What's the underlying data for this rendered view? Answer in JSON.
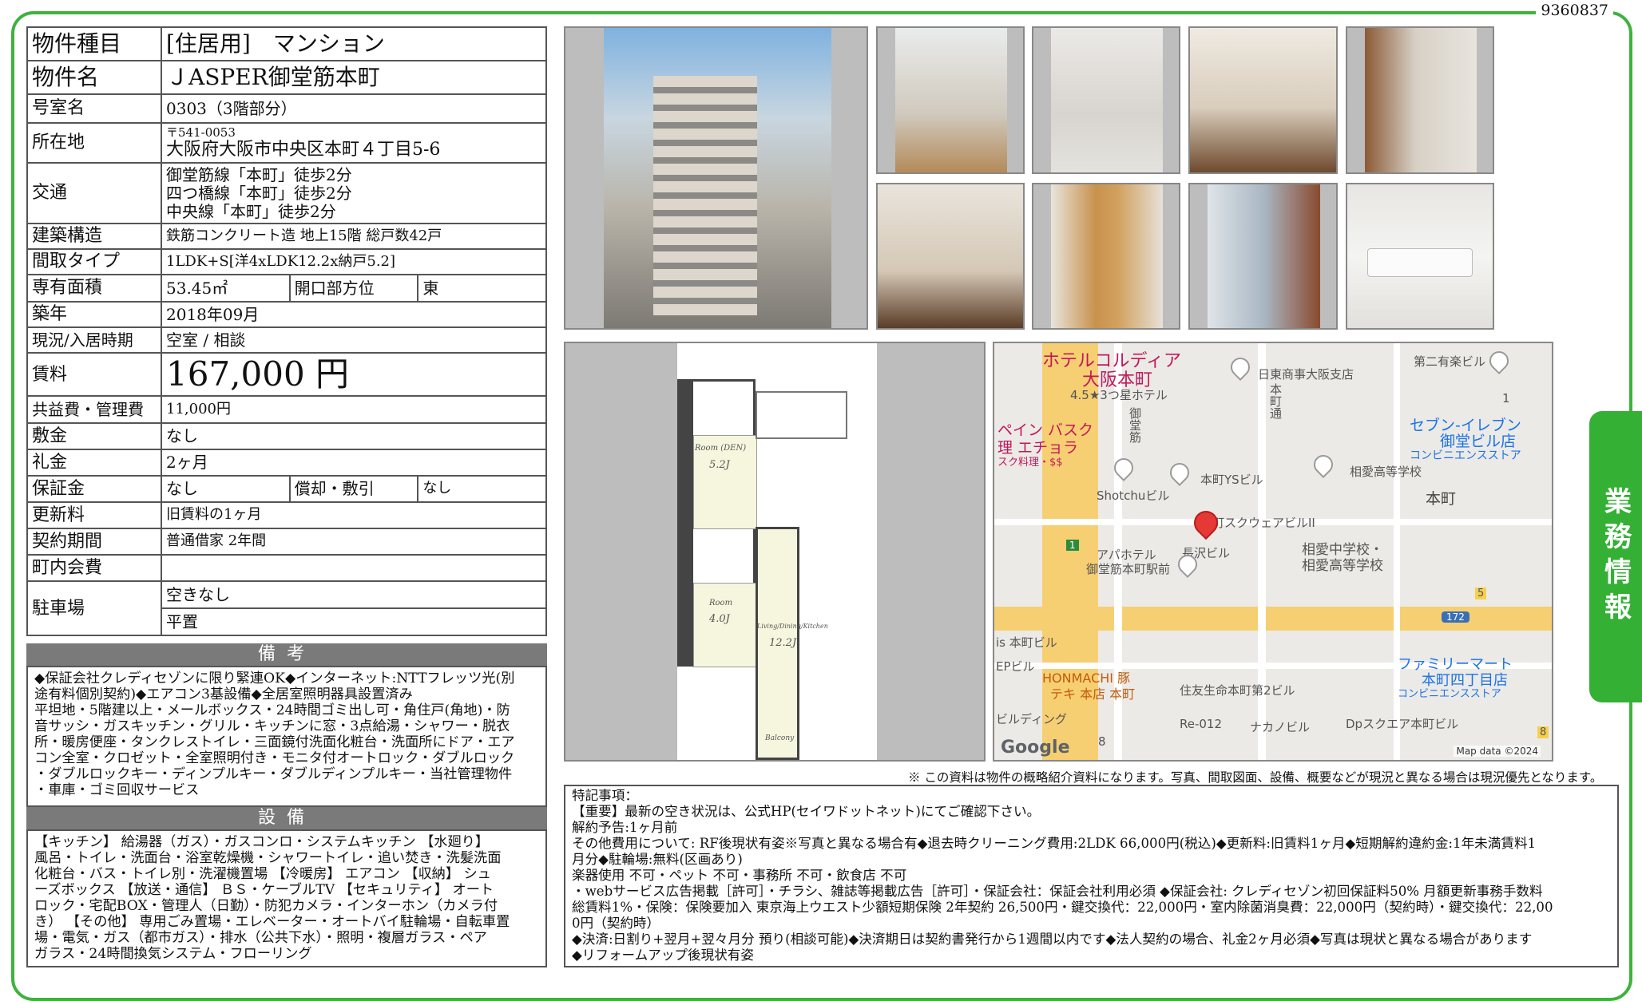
{
  "doc_id": "9360837",
  "side_tab": "業務情報",
  "property": {
    "type_label": "物件種目",
    "type_value": "[住居用]　マンション",
    "name_label": "物件名",
    "name_value": "ＪASPER御堂筋本町",
    "room_label": "号室名",
    "room_value": "0303（3階部分）",
    "address_label": "所在地",
    "postal": "〒541-0053",
    "address": "大阪府大阪市中央区本町４丁目5-6",
    "transit_label": "交通",
    "transit": [
      "御堂筋線「本町」徒歩2分",
      "四つ橋線「本町」徒歩2分",
      "中央線「本町」徒歩2分"
    ],
    "structure_label": "建築構造",
    "structure_value": "鉄筋コンクリート造 地上15階 総戸数42戸",
    "layout_label": "間取タイプ",
    "layout_value": "1LDK+S[洋4xLDK12.2x納戸5.2]",
    "area_label": "専有面積",
    "area_value": "53.45㎡",
    "facing_label": "開口部方位",
    "facing_value": "東",
    "built_label": "築年",
    "built_value": "2018年09月",
    "status_label": "現況/入居時期",
    "status_value": "空室 / 相談",
    "rent_label": "賃料",
    "rent_value": "167,000 円",
    "fee_label": "共益費・管理費",
    "fee_value": "11,000円",
    "deposit_label": "敷金",
    "deposit_value": "なし",
    "key_money_label": "礼金",
    "key_money_value": "2ヶ月",
    "guarantee_label": "保証金",
    "guarantee_value": "なし",
    "amort_label": "償却・敷引",
    "amort_value": "なし",
    "renewal_label": "更新料",
    "renewal_value": "旧賃料の1ヶ月",
    "contract_label": "契約期間",
    "contract_value": "普通借家 2年間",
    "community_label": "町内会費",
    "community_value": "",
    "parking_label": "駐車場",
    "parking_value1": "空きなし",
    "parking_value2": "平置"
  },
  "biko": {
    "title": "備考",
    "lines": [
      "◆保証会社クレディセゾンに限り緊連OK◆インターネット:NTTフレッツ光(別",
      "途有料個別契約)◆エアコン3基設備◆全居室照明器具設置済み",
      "平坦地・5階建以上・メールボックス・24時間ゴミ出し可・角住戸(角地)・防",
      "音サッシ・ガスキッチン・グリル・キッチンに窓・3点給湯・シャワー・脱衣",
      "所・暖房便座・タンクレストイレ・三面鏡付洗面化粧台・洗面所にドア・エア",
      "コン全室・クロゼット・全室照明付き・モニタ付オートロック・ダブルロック",
      "・ダブルロックキー・ディンプルキー・ダブルディンプルキー・当社管理物件",
      "・車庫・ゴミ回収サービス"
    ]
  },
  "setsubi": {
    "title": "設備",
    "lines": [
      "【キッチン】 給湯器（ガス）・ガスコンロ・システムキッチン 【水廻り】",
      "風呂・トイレ・洗面台・浴室乾燥機・シャワートイレ・追い焚き・洗髪洗面",
      "化粧台・バス・トイレ別・洗濯機置場 【冷暖房】 エアコン 【収納】 シュ",
      "ーズボックス 【放送・通信】 ＢＳ・ケーブルTV 【セキュリティ】 オート",
      "ロック・宅配BOX・管理人（日勤）・防犯カメラ・インターホン（カメラ付",
      "き） 【その他】 専用ごみ置場・エレベーター・オートバイ駐輪場・自転車置",
      "場・電気・ガス（都市ガス）・排水（公共下水）・照明・複層ガラス・ペア",
      "ガラス・24時間換気システム・フローリング"
    ]
  },
  "floorplan": {
    "room1_label": "Room (DEN)",
    "room1_size": "5.2J",
    "room2_label": "Room",
    "room2_size": "4.0J",
    "ldk_label": "Living/Dining/Kitchen",
    "ldk_size": "12.2J",
    "balcony": "Balcony"
  },
  "map": {
    "hotel": "ホテルコルディア",
    "hotel2": "大阪本町",
    "hotel_rating": "4.5★3つ星ホテル",
    "nittou": "日東商事大阪支店",
    "daini": "第二有楽ビル",
    "seven": "セブン-イレブン",
    "seven2": "御堂ビル店",
    "seven3": "コンビニエンスストア",
    "aikou": "相愛高等学校",
    "honmachi_ys": "本町YSビル",
    "honmachi_sq": "本町スクウェアビルII",
    "shotchu": "Shotchuビル",
    "nagasawa": "長沢ビル",
    "aikou_school": "相愛中学校・",
    "aikou_school2": "相愛高等学校",
    "apa": "アパホテル",
    "apa2": "御堂筋本町駅前",
    "honmachi": "本町",
    "spain": "ペイン バスク",
    "spain2": "理 エチョラ",
    "spain3": "スク料理・$$",
    "street1": "御堂筋",
    "street2": "本町通",
    "is_bldg": "is 本町ビル",
    "ep_bldg": "EPビル",
    "bldg_ing": "ビルディング",
    "honmachi_buta": "HONMACHI 豚",
    "honmachi_buta2": "テキ 本店 本町",
    "sumitomo": "住友生命本町第2ビル",
    "re012": "Re-012",
    "nakano": "ナカノビル",
    "dp": "Dpスクエア本町ビル",
    "family": "ファミリーマート",
    "family2": "本町四丁目店",
    "family3": "コンビニエンスストア",
    "route172": "172",
    "num1": "1",
    "num5": "5",
    "num8": "8",
    "num8b": "8",
    "route1": "1",
    "google": "Google",
    "map_data": "Map data ©2024"
  },
  "note": "※ この資料は物件の概略紹介資料になります。写真、間取図面、設備、概要などが現況と異なる場合は現況優先となります。",
  "remarks": {
    "lines": [
      "特記事項：",
      "【重要】最新の空き状況は、公式HP(セイワドットネット)にてご確認下さい。",
      "解約予告:1ヶ月前",
      "その他費用について: RF後現状有姿※写真と異なる場合有◆退去時クリーニング費用:2LDK 66,000円(税込)◆更新料:旧賃料1ヶ月◆短期解約違約金:1年未満賃料1",
      "月分◆駐輪場:無料(区画あり)",
      "楽器使用 不可・ペット 不可・事務所 不可・飲食店 不可",
      "・webサービス広告掲載［許可］・チラシ、雑誌等掲載広告［許可］・保証会社：保証会社利用必須 ◆保証会社: クレディセゾン初回保証料50% 月額更新事務手数料",
      "総賃料1%・保険：保険要加入 東京海上ウエスト少額短期保険 2年契約 26,500円・鍵交換代：22,000円・室内除菌消臭費：22,000円（契約時）・鍵交換代：22,00",
      "0円（契約時）",
      "◆決済:日割り+翌月+翌々月分 預り(相談可能)◆決済期日は契約書発行から1週間以内です◆法人契約の場合、礼金2ヶ月必須◆写真は現状と異なる場合があります",
      "◆リフォームアップ後現状有姿"
    ]
  }
}
